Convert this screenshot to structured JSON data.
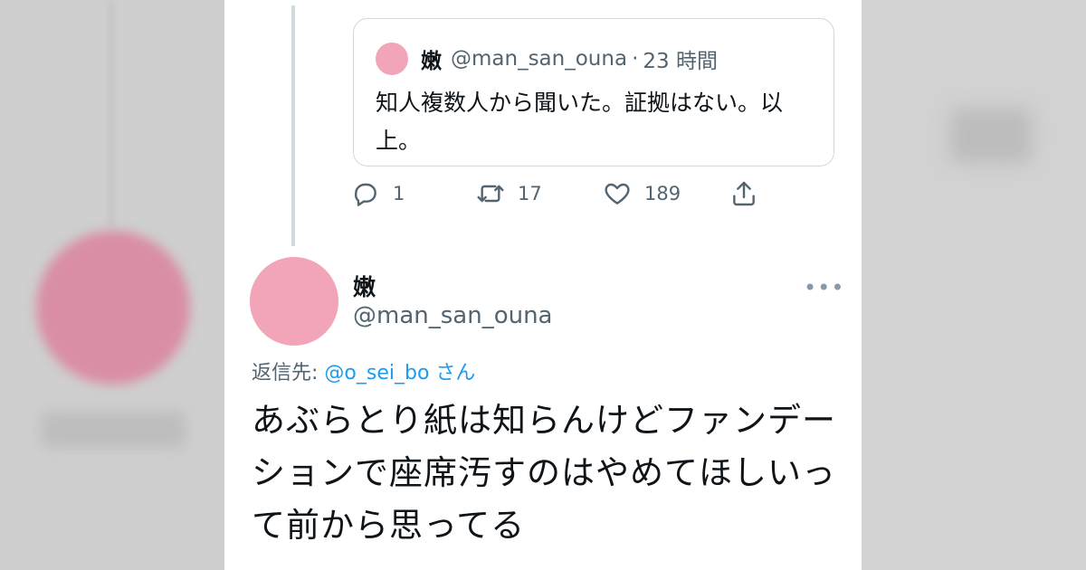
{
  "quoted_tweet": {
    "name": "嫩",
    "handle": "@man_san_ouna",
    "separator": "·",
    "time": "23 時間",
    "text": "知人複数人から聞いた。証拠はない。以上。"
  },
  "actions": {
    "reply_count": "1",
    "retweet_count": "17",
    "like_count": "189"
  },
  "tweet": {
    "name": "嫩",
    "handle": "@man_san_ouna",
    "more": "•••",
    "reply_prefix": "返信先: ",
    "reply_mention": "@o_sei_bo",
    "reply_suffix": " さん",
    "text": "あぶらとり紙は知らんけどファンデーションで座席汚すのはやめてほしいって前から思ってる"
  },
  "colors": {
    "accent": "#1d9bf0",
    "avatar": "#f2a5b8",
    "muted_text": "#536471"
  },
  "icons": [
    "reply-icon",
    "retweet-icon",
    "like-icon",
    "share-icon",
    "more-icon"
  ]
}
